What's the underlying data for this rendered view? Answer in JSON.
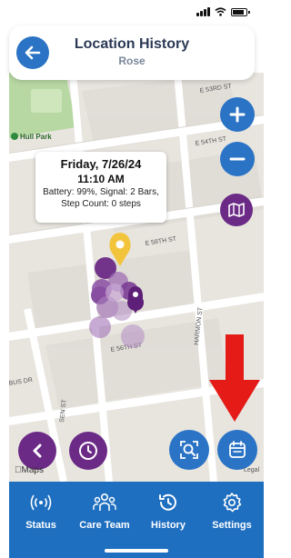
{
  "header": {
    "title": "Location History",
    "subtitle": "Rose"
  },
  "map": {
    "park_label": "Hull Park",
    "street_labels": [
      "E 53RD ST",
      "E 54TH ST",
      "E 58TH ST",
      "HARMON ST",
      "E 56TH ST",
      "BUS DR",
      "SEN ST"
    ],
    "maps_logo": "Maps",
    "legal_text": "Legal"
  },
  "tooltip": {
    "date": "Friday, 7/26/24",
    "time": "11:10 AM",
    "line1": "Battery: 99%, Signal: 2 Bars,",
    "line2": "Step Count: 0 steps"
  },
  "map_controls": {
    "zoom_in": "plus-icon",
    "zoom_out": "minus-icon",
    "map_type": "map-icon",
    "prev": "chevron-left-icon",
    "time": "clock-icon",
    "search_area": "search-zoom-icon",
    "calendar": "calendar-icon"
  },
  "annotation": {
    "arrow_color": "#e41b17"
  },
  "tabs": [
    {
      "label": "Status",
      "icon": "signal-icon"
    },
    {
      "label": "Care Team",
      "icon": "team-icon"
    },
    {
      "label": "History",
      "icon": "history-icon"
    },
    {
      "label": "Settings",
      "icon": "gear-icon"
    }
  ],
  "colors": {
    "accent_blue": "#2a73c5",
    "accent_purple": "#6b2a86",
    "tabbar": "#1f6fc0"
  }
}
